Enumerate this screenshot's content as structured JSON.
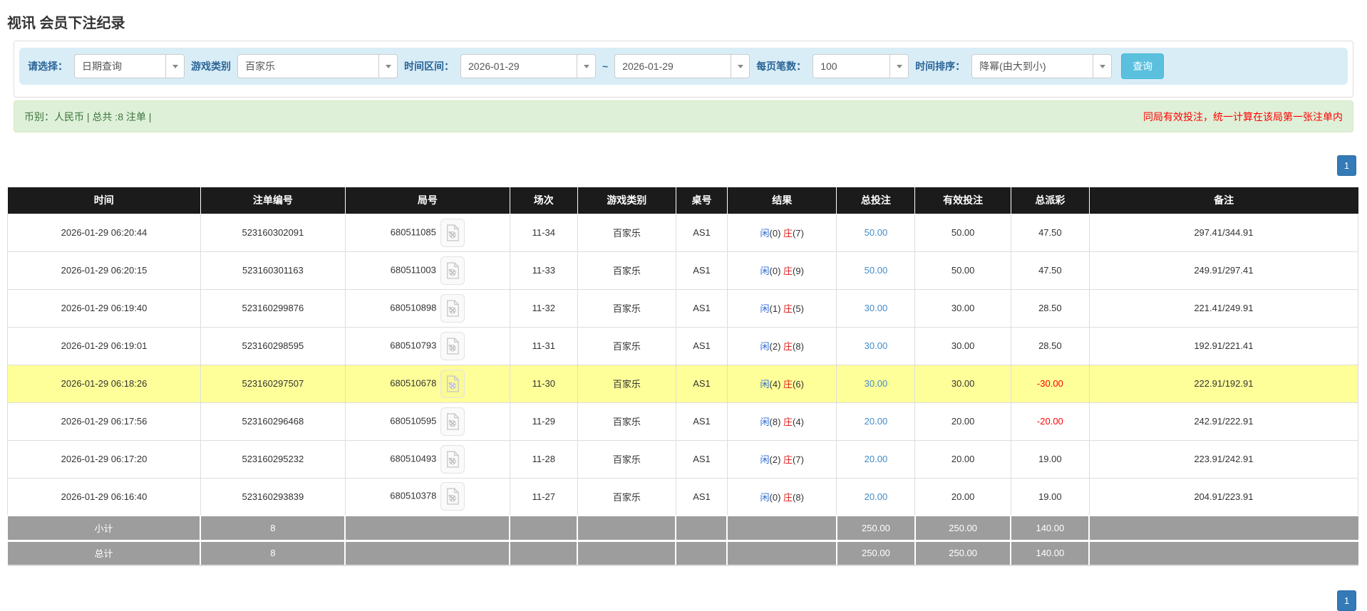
{
  "page": {
    "title": "视讯 会员下注纪录"
  },
  "filters": {
    "select_label": "请选择：",
    "select_value": "日期查询",
    "game_label": "游戏类别",
    "game_value": "百家乐",
    "range_label": "时间区间：",
    "date_from": "2026-01-29",
    "tilde": "~",
    "date_to": "2026-01-29",
    "per_page_label": "每页笔数：",
    "per_page_value": "100",
    "sort_label": "时间排序：",
    "sort_value": "降幂(由大到小)",
    "search_button": "查询"
  },
  "summary": {
    "left_text": "币别：人民币 | 总共 :8 注单 |",
    "right_text": "同局有效投注，统一计算在该局第一张注单内"
  },
  "pagination": {
    "page": "1"
  },
  "table": {
    "headers": [
      "时间",
      "注单编号",
      "局号",
      "场次",
      "游戏类别",
      "桌号",
      "结果",
      "总投注",
      "有效投注",
      "总派彩",
      "备注"
    ],
    "rows": [
      {
        "row_class": "",
        "time": "2026-01-29 06:20:44",
        "bet_no": "523160302091",
        "round_no": "680511085",
        "session": "11-34",
        "game": "百家乐",
        "table_no": "AS1",
        "result": {
          "p": "闲",
          "pn": "(0)",
          "b": "庄",
          "bn": "(7)"
        },
        "total_bet": "50.00",
        "valid_bet": "50.00",
        "payout": "47.50",
        "payout_class": "payout",
        "note": "297.41/344.91"
      },
      {
        "row_class": "",
        "time": "2026-01-29 06:20:15",
        "bet_no": "523160301163",
        "round_no": "680511003",
        "session": "11-33",
        "game": "百家乐",
        "table_no": "AS1",
        "result": {
          "p": "闲",
          "pn": "(0)",
          "b": "庄",
          "bn": "(9)"
        },
        "total_bet": "50.00",
        "valid_bet": "50.00",
        "payout": "47.50",
        "payout_class": "payout",
        "note": "249.91/297.41"
      },
      {
        "row_class": "",
        "time": "2026-01-29 06:19:40",
        "bet_no": "523160299876",
        "round_no": "680510898",
        "session": "11-32",
        "game": "百家乐",
        "table_no": "AS1",
        "result": {
          "p": "闲",
          "pn": "(1)",
          "b": "庄",
          "bn": "(5)"
        },
        "total_bet": "30.00",
        "valid_bet": "30.00",
        "payout": "28.50",
        "payout_class": "payout",
        "note": "221.41/249.91"
      },
      {
        "row_class": "",
        "time": "2026-01-29 06:19:01",
        "bet_no": "523160298595",
        "round_no": "680510793",
        "session": "11-31",
        "game": "百家乐",
        "table_no": "AS1",
        "result": {
          "p": "闲",
          "pn": "(2)",
          "b": "庄",
          "bn": "(8)"
        },
        "total_bet": "30.00",
        "valid_bet": "30.00",
        "payout": "28.50",
        "payout_class": "payout",
        "note": "192.91/221.41"
      },
      {
        "row_class": "hl",
        "time": "2026-01-29 06:18:26",
        "bet_no": "523160297507",
        "round_no": "680510678",
        "session": "11-30",
        "game": "百家乐",
        "table_no": "AS1",
        "result": {
          "p": "闲",
          "pn": "(4)",
          "b": "庄",
          "bn": "(6)"
        },
        "total_bet": "30.00",
        "valid_bet": "30.00",
        "payout": "-30.00",
        "payout_class": "payout neg",
        "note": "222.91/192.91"
      },
      {
        "row_class": "",
        "time": "2026-01-29 06:17:56",
        "bet_no": "523160296468",
        "round_no": "680510595",
        "session": "11-29",
        "game": "百家乐",
        "table_no": "AS1",
        "result": {
          "p": "闲",
          "pn": "(8)",
          "b": "庄",
          "bn": "(4)"
        },
        "total_bet": "20.00",
        "valid_bet": "20.00",
        "payout": "-20.00",
        "payout_class": "payout neg",
        "note": "242.91/222.91"
      },
      {
        "row_class": "",
        "time": "2026-01-29 06:17:20",
        "bet_no": "523160295232",
        "round_no": "680510493",
        "session": "11-28",
        "game": "百家乐",
        "table_no": "AS1",
        "result": {
          "p": "闲",
          "pn": "(2)",
          "b": "庄",
          "bn": "(7)"
        },
        "total_bet": "20.00",
        "valid_bet": "20.00",
        "payout": "19.00",
        "payout_class": "payout",
        "note": "223.91/242.91"
      },
      {
        "row_class": "",
        "time": "2026-01-29 06:16:40",
        "bet_no": "523160293839",
        "round_no": "680510378",
        "session": "11-27",
        "game": "百家乐",
        "table_no": "AS1",
        "result": {
          "p": "闲",
          "pn": "(0)",
          "b": "庄",
          "bn": "(8)"
        },
        "total_bet": "20.00",
        "valid_bet": "20.00",
        "payout": "19.00",
        "payout_class": "payout",
        "note": "204.91/223.91"
      }
    ],
    "footer": [
      {
        "label": "小计",
        "count": "8",
        "total_bet": "250.00",
        "valid_bet": "250.00",
        "payout": "140.00"
      },
      {
        "label": "总计",
        "count": "8",
        "total_bet": "250.00",
        "valid_bet": "250.00",
        "payout": "140.00"
      }
    ]
  },
  "colors": {
    "header_bg": "#1b1b1b",
    "highlight_row": "#ffff99",
    "link_blue": "#428bca",
    "player_blue": "#2a6cd8",
    "banker_red": "#dd2222",
    "negative_red": "#ff0000",
    "summary_bg": "#dff0d8",
    "summary_text": "#3c763d",
    "warning_red": "#ff0000",
    "footer_gray": "#9d9d9d",
    "filter_bar_bg": "#d9edf7",
    "filter_label_blue": "#2a6496",
    "search_button_bg": "#5bc0de",
    "pagination_bg": "#337ab7"
  }
}
